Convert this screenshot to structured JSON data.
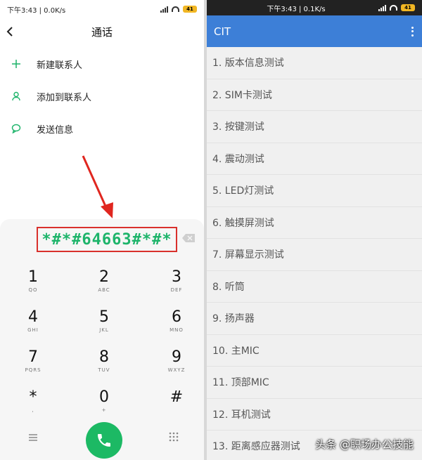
{
  "left": {
    "status": {
      "text": "下午3:43 | 0.0K/s",
      "battery": "41"
    },
    "title": "通话",
    "actions": [
      {
        "label": "新建联系人",
        "icon": "plus-icon"
      },
      {
        "label": "添加到联系人",
        "icon": "person-icon"
      },
      {
        "label": "发送信息",
        "icon": "message-icon"
      }
    ],
    "dialed_number": "*#*#64663#*#*",
    "keys": [
      {
        "digit": "1",
        "letters": "QO"
      },
      {
        "digit": "2",
        "letters": "ABC"
      },
      {
        "digit": "3",
        "letters": "DEF"
      },
      {
        "digit": "4",
        "letters": "GHI"
      },
      {
        "digit": "5",
        "letters": "JKL"
      },
      {
        "digit": "6",
        "letters": "MNO"
      },
      {
        "digit": "7",
        "letters": "PQRS"
      },
      {
        "digit": "8",
        "letters": "TUV"
      },
      {
        "digit": "9",
        "letters": "WXYZ"
      },
      {
        "digit": "*",
        "letters": ","
      },
      {
        "digit": "0",
        "letters": "+"
      },
      {
        "digit": "#",
        "letters": ""
      }
    ]
  },
  "right": {
    "status": {
      "text": "下午3:43 | 0.1K/s",
      "battery": "41"
    },
    "app_title": "CIT",
    "items": [
      "1. 版本信息测试",
      "2. SIM卡测试",
      "3. 按键测试",
      "4. 震动测试",
      "5. LED灯测试",
      "6. 触摸屏测试",
      "7. 屏幕显示测试",
      "8. 听筒",
      "9. 扬声器",
      "10. 主MIC",
      "11. 顶部MIC",
      "12. 耳机测试",
      "13. 距离感应器测试"
    ]
  },
  "watermark": "头条 @职场办公技能",
  "colors": {
    "accent_green": "#1db46a",
    "call_green": "#1cb964",
    "highlight_red": "#d9302c",
    "appbar_blue": "#3d7fd7"
  }
}
